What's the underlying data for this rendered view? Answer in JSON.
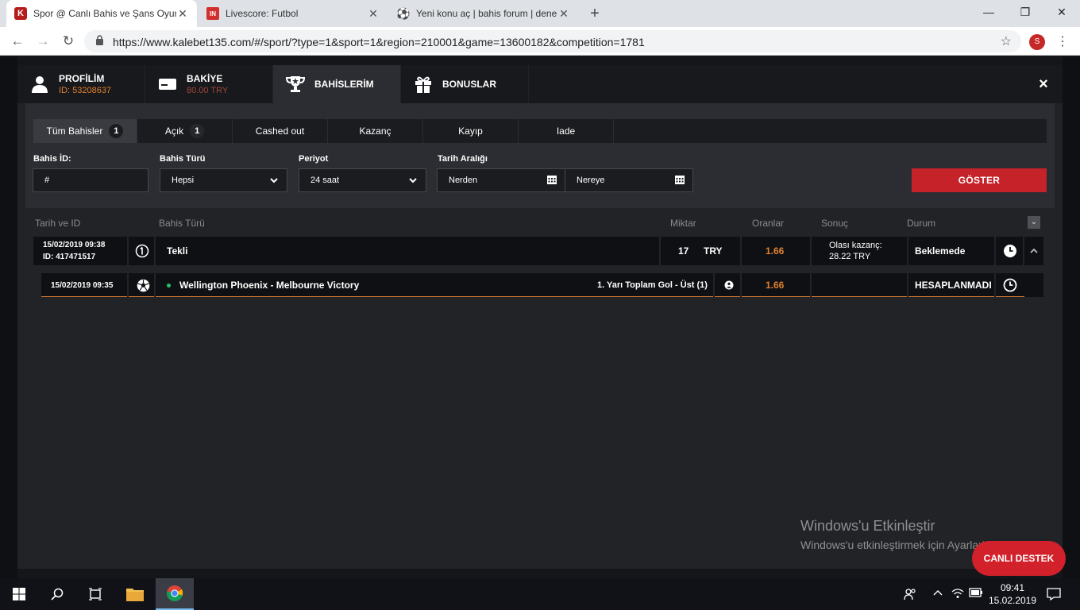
{
  "browser": {
    "tabs": [
      {
        "title": "Spor @ Canlı Bahis ve Şans Oyun",
        "favicon": "K"
      },
      {
        "title": "Livescore: Futbol",
        "favicon": "IN"
      },
      {
        "title": "Yeni konu aç | bahis forum | dene",
        "favicon": "⚽"
      }
    ],
    "url": "https://www.kalebet135.com/#/sport/?type=1&sport=1&region=210001&game=13600182&competition=1781",
    "profile_initial": "S"
  },
  "modal": {
    "tabs": [
      {
        "label": "PROFİLİM",
        "sub": "ID: 53208637"
      },
      {
        "label": "BAKİYE",
        "sub": "80.00 TRY"
      },
      {
        "label": "BAHİSLERİM",
        "sub": ""
      },
      {
        "label": "BONUSLAR",
        "sub": ""
      }
    ],
    "close": "×"
  },
  "filters": {
    "tabs": [
      {
        "label": "Tüm Bahisler",
        "badge": "1"
      },
      {
        "label": "Açık",
        "badge": "1"
      },
      {
        "label": "Cashed out",
        "badge": ""
      },
      {
        "label": "Kazanç",
        "badge": ""
      },
      {
        "label": "Kayıp",
        "badge": ""
      },
      {
        "label": "Iade",
        "badge": ""
      }
    ],
    "bahis_id_label": "Bahis İD:",
    "bahis_id_value": "#",
    "bahis_turu_label": "Bahis Türü",
    "bahis_turu_value": "Hepsi",
    "periyot_label": "Periyot",
    "periyot_value": "24 saat",
    "tarih_label": "Tarih Aralığı",
    "nerden": "Nerden",
    "nereye": "Nereye",
    "goster": "GÖSTER"
  },
  "table": {
    "headers": [
      "Tarih ve ID",
      "Bahis Türü",
      "Miktar",
      "Oranlar",
      "Sonuç",
      "Durum"
    ],
    "bet": {
      "date": "15/02/2019 09:38",
      "id": "ID: 417471517",
      "type_icon": "①",
      "type": "Tekli",
      "amount": "17",
      "currency": "TRY",
      "odds": "1.66",
      "result_label": "Olası kazanç:",
      "result_value": "28.22 TRY",
      "status": "Beklemede"
    },
    "selection": {
      "date": "15/02/2019 09:35",
      "match": "Wellington Phoenix - Melbourne Victory",
      "market": "1. Yarı Toplam Gol - Üst (1)",
      "odds": "1.66",
      "status": "HESAPLANMADI"
    }
  },
  "watermark": {
    "title": "Windows'u Etkinleştir",
    "sub": "Windows'u etkinleştirmek için Ayarlar'a gidin."
  },
  "support_button": "CANLI DESTEK",
  "taskbar": {
    "time": "09:41",
    "date": "15.02.2019"
  }
}
